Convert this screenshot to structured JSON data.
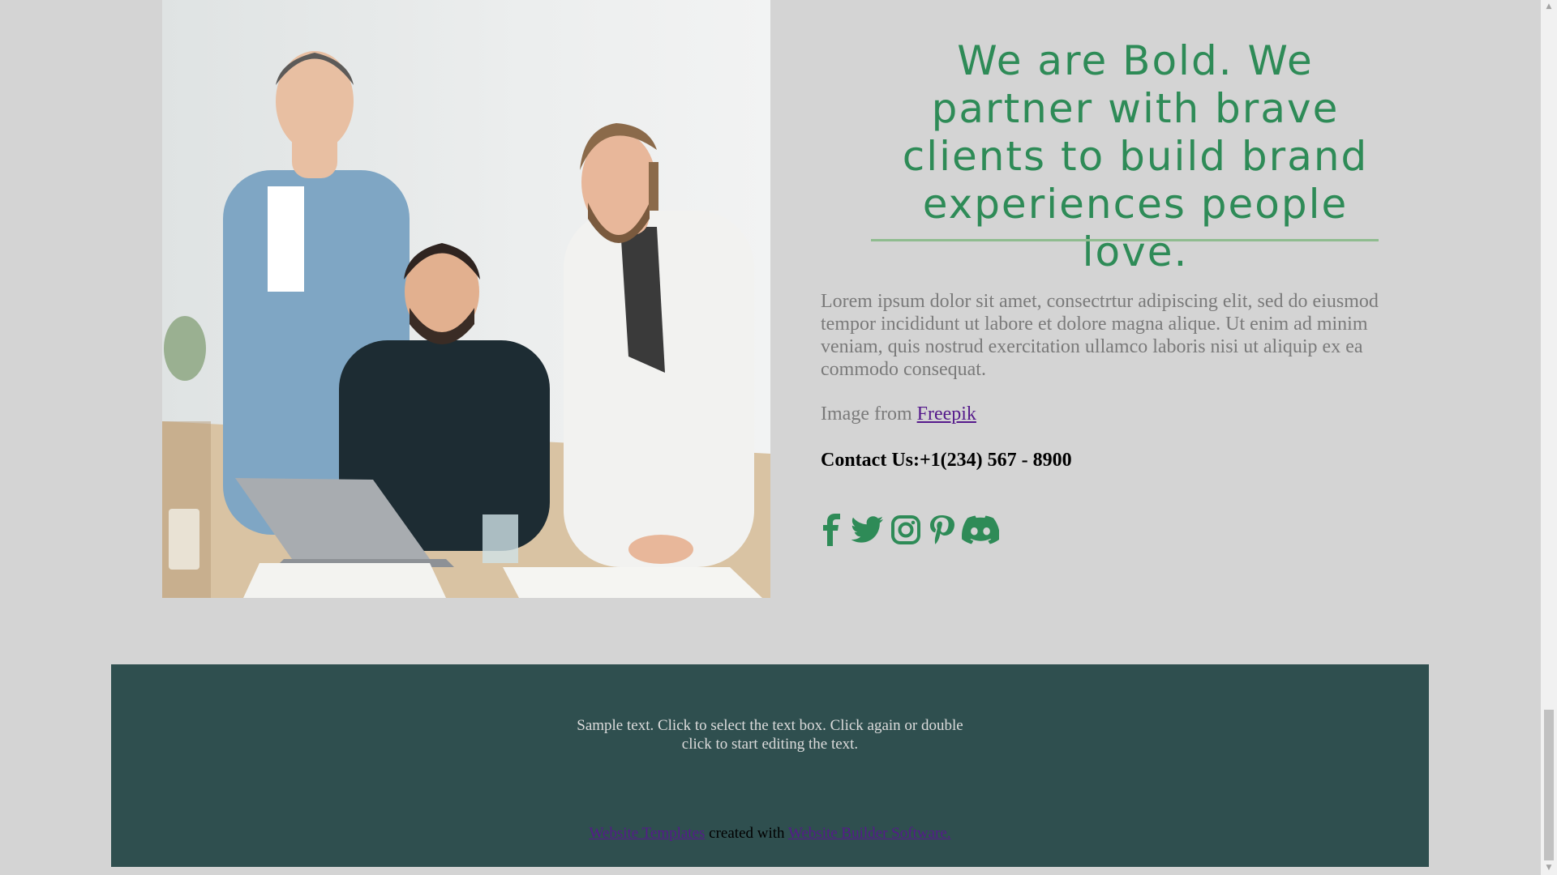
{
  "hero": {
    "image_alt": "Three smiling colleagues gathered around a laptop at an office desk",
    "headline": "We are Bold. We partner with brave clients to build brand experiences people love.",
    "body": "Lorem ipsum dolor sit amet, consectrtur adipiscing elit, sed do eiusmod tempor incididunt ut labore et dolore magna alique. Ut enim ad minim veniam, quis nostrud exercitation ullamco laboris nisi ut aliquip ex ea commodo consequat.",
    "credit_prefix": "Image from ",
    "credit_link": "Freepik",
    "contact": "Contact Us:+1(234) 567 - 8900"
  },
  "socials": [
    {
      "icon": "facebook-icon"
    },
    {
      "icon": "twitter-icon"
    },
    {
      "icon": "instagram-icon"
    },
    {
      "icon": "pinterest-icon"
    },
    {
      "icon": "discord-icon"
    }
  ],
  "footer": {
    "text_line1": "Sample text. Click to select the text box. Click again or double",
    "text_line2": "click to start editing the text.",
    "credit_link1": "Website Templates",
    "credit_middle": " created with ",
    "credit_link2": "Website Builder Software."
  },
  "colors": {
    "accent": "#2e8b57",
    "page_background": "#d4d4d4",
    "footer_background": "#2f4f4f"
  }
}
